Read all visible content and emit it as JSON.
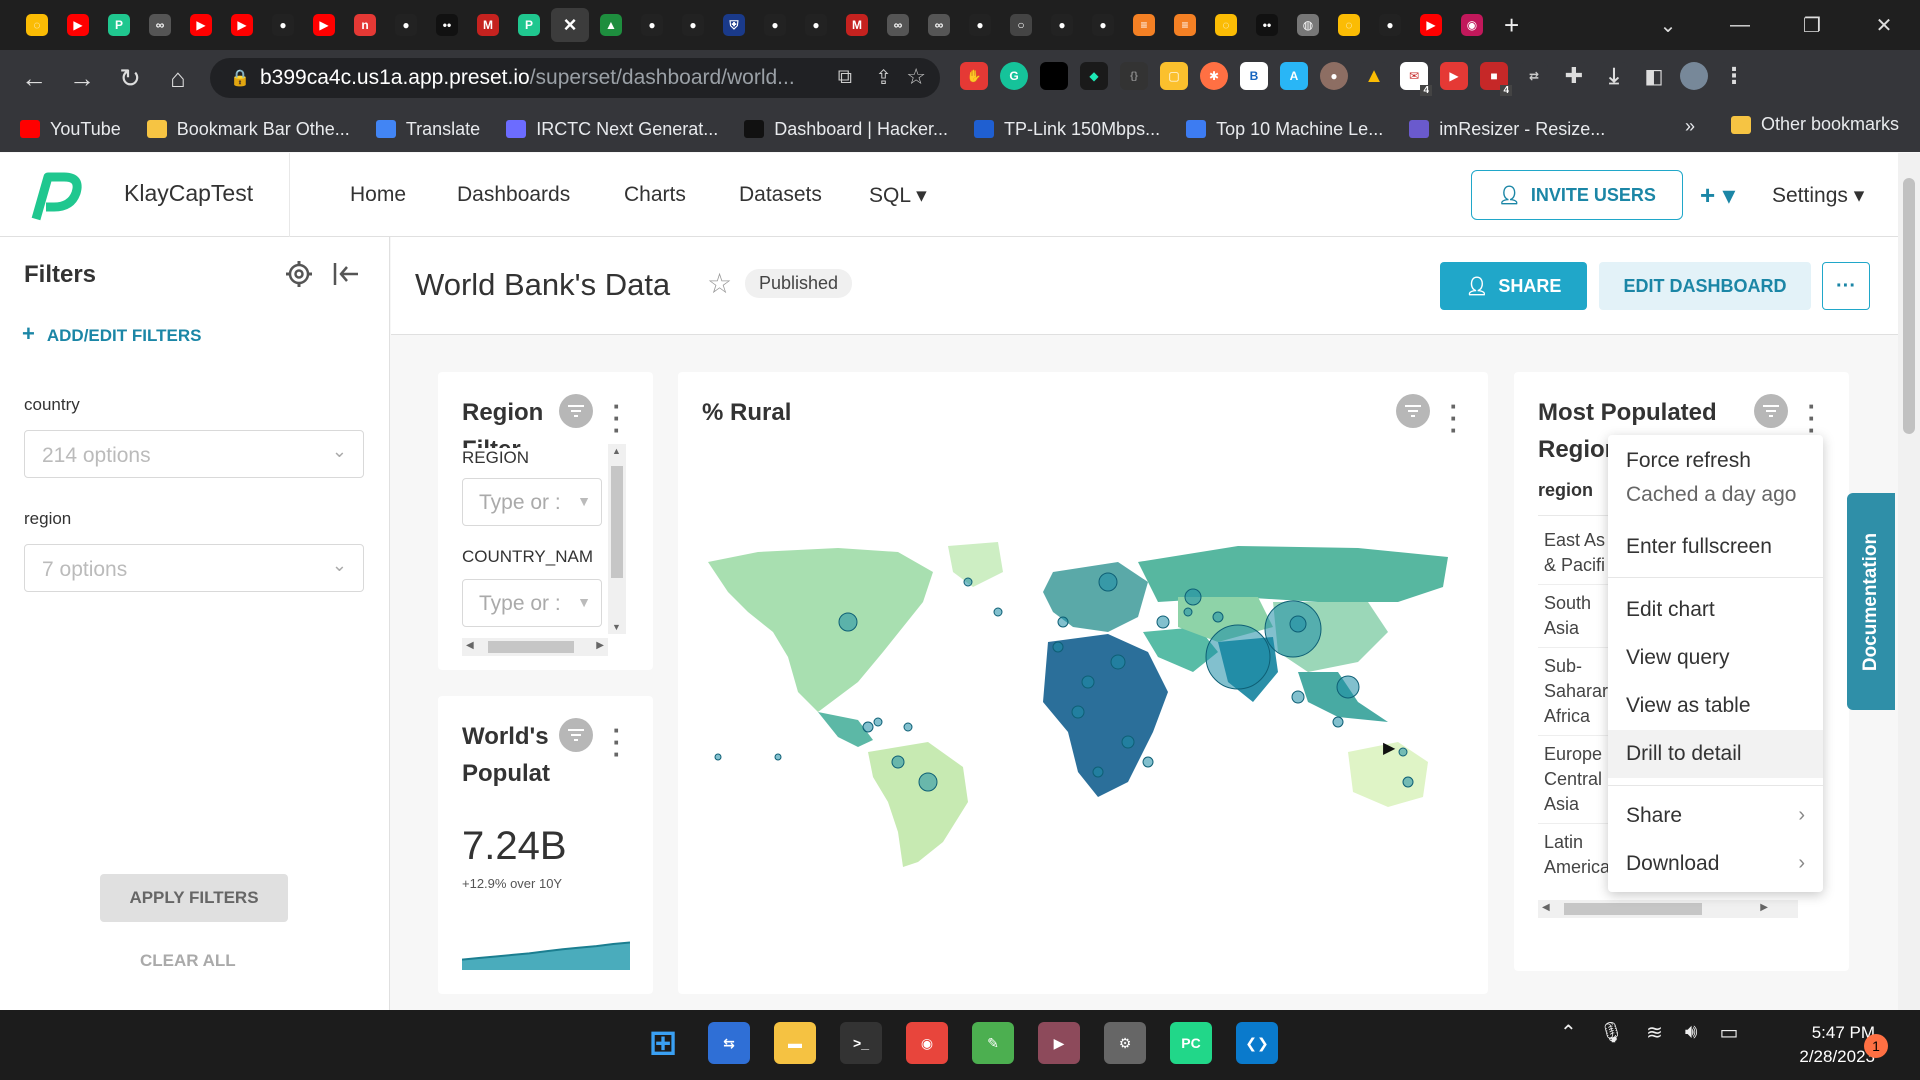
{
  "browser": {
    "tabs": [
      "loading",
      "youtube",
      "preset",
      "glasses",
      "youtube",
      "youtube",
      "github",
      "youtube",
      "n-app",
      "github",
      "medium",
      "gmail",
      "preset",
      "close",
      "drive",
      "github",
      "github",
      "shield",
      "github",
      "github",
      "gmail",
      "glasses",
      "glasses",
      "github",
      "o",
      "github",
      "github",
      "stack",
      "stack",
      "loading",
      "medium",
      "globe",
      "loading",
      "github",
      "youtube",
      "record"
    ],
    "active_tab_close": "×",
    "new_tab": "+",
    "window_controls": [
      "⌄",
      "—",
      "❐",
      "✕"
    ],
    "url_host": "b399ca4c.us1a.app.preset.io",
    "url_path": "/superset/dashboard/world...",
    "bookmarks": [
      {
        "label": "YouTube",
        "color": "#ff0000"
      },
      {
        "label": "Bookmark Bar Othe...",
        "color": "#f6c443"
      },
      {
        "label": "Translate",
        "color": "#4285f4"
      },
      {
        "label": "IRCTC Next Generat...",
        "color": "#6c6cff"
      },
      {
        "label": "Dashboard | Hacker...",
        "color": "#111111"
      },
      {
        "label": "TP-Link 150Mbps...",
        "color": "#1f5fd1"
      },
      {
        "label": "Top 10 Machine Le...",
        "color": "#3d7cf2"
      },
      {
        "label": "imResizer - Resize...",
        "color": "#6a5acd"
      }
    ],
    "bookmarks_overflow": "»",
    "other_bookmarks": "Other bookmarks",
    "ext_badges": {
      "mail": "4",
      "video": "4"
    }
  },
  "app": {
    "brand": "KlayCapTest",
    "nav": [
      "Home",
      "Dashboards",
      "Charts",
      "Datasets",
      "SQL ▾"
    ],
    "invite": "INVITE USERS",
    "plus": "+ ▾",
    "settings": "Settings ▾"
  },
  "filters": {
    "title": "Filters",
    "add": "ADD/EDIT FILTERS",
    "country_label": "country",
    "country_placeholder": "214 options",
    "region_label": "region",
    "region_placeholder": "7 options",
    "apply": "APPLY FILTERS",
    "clear": "CLEAR ALL"
  },
  "dashboard": {
    "title": "World Bank's Data",
    "status": "Published",
    "share": "SHARE",
    "edit": "EDIT DASHBOARD",
    "more": "···"
  },
  "cards": {
    "region_filter": {
      "title": "Region Filter",
      "region_label": "REGION",
      "country_label": "COUNTRY_NAM",
      "placeholder": "Type or :"
    },
    "world_pop": {
      "title": "World's Populat",
      "value": "7.24B",
      "delta": "+12.9% over 10Y",
      "trend": [
        0.2,
        0.23,
        0.26,
        0.29,
        0.32,
        0.36,
        0.4,
        0.43,
        0.46,
        0.5,
        0.53
      ]
    },
    "map": {
      "title": "% Rural"
    },
    "most_populated": {
      "title": "Most Populated Regior",
      "column": "region",
      "rows": [
        [
          "East As",
          "& Pacifi"
        ],
        [
          "South",
          "Asia"
        ],
        [
          "Sub-",
          "Saharar",
          "Africa"
        ],
        [
          "Europe",
          "Central",
          "Asia"
        ],
        [
          "Latin",
          "America"
        ]
      ]
    }
  },
  "context_menu": {
    "force_refresh": "Force refresh",
    "cached": "Cached a day ago",
    "fullscreen": "Enter fullscreen",
    "edit_chart": "Edit chart",
    "view_query": "View query",
    "view_table": "View as table",
    "drill": "Drill to detail",
    "share": "Share",
    "download": "Download"
  },
  "documentation": "Documentation",
  "taskbar": {
    "clock_time": "5:47 PM",
    "clock_date": "2/28/2023",
    "notifications": "1",
    "icons": [
      {
        "name": "windows",
        "color": "#3aa0f3"
      },
      {
        "name": "network-app",
        "color": "#2f6fd6"
      },
      {
        "name": "file-explorer",
        "color": "#f5c242"
      },
      {
        "name": "terminal",
        "color": "#333333"
      },
      {
        "name": "chrome",
        "color": "#e8453c"
      },
      {
        "name": "notepad",
        "color": "#4caf50"
      },
      {
        "name": "media",
        "color": "#8d4a5b"
      },
      {
        "name": "settings",
        "color": "#666666"
      },
      {
        "name": "pycharm",
        "color": "#21d789"
      },
      {
        "name": "vscode",
        "color": "#0a7acc"
      }
    ]
  },
  "colors": {
    "accent": "#20a7c9",
    "accent_dark": "#1b86a6",
    "map_low": "#d6f0c8",
    "map_high": "#1d2f6a"
  }
}
